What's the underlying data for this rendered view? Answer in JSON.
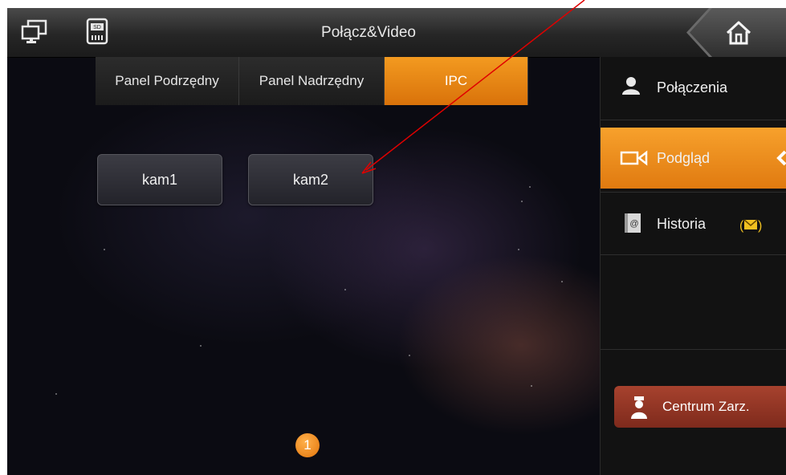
{
  "header": {
    "title": "Połącz&Video",
    "sd_label": "SD"
  },
  "tabs": [
    {
      "label": "Panel Podrzędny",
      "active": false
    },
    {
      "label": "Panel Nadrzędny",
      "active": false
    },
    {
      "label": "IPC",
      "active": true
    }
  ],
  "cameras": [
    {
      "label": "kam1"
    },
    {
      "label": "kam2"
    }
  ],
  "pager": {
    "current": "1"
  },
  "sidebar": {
    "items": [
      {
        "label": "Połączenia",
        "icon": "person-icon",
        "active": false
      },
      {
        "label": "Podgląd",
        "icon": "camera-icon",
        "active": true
      },
      {
        "label": "Historia",
        "icon": "history-icon",
        "active": false
      }
    ],
    "center_button": {
      "label": "Centrum Zarz."
    }
  },
  "colors": {
    "accent": "#f39a20",
    "center_button": "#9a3a28",
    "annotation_arrow": "#e00000"
  }
}
